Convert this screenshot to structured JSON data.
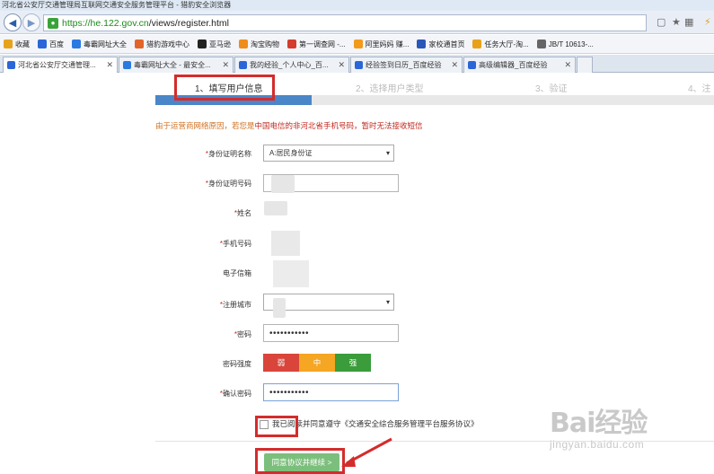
{
  "window": {
    "title": "河北省公安厅交通管理局互联网交通安全服务管理平台 - 猎豹安全浏览器"
  },
  "address": {
    "scheme": "https://",
    "host": "he.122.gov.cn",
    "path": "/views/register.html"
  },
  "favorites": [
    {
      "label": "收藏",
      "color": "#e8a21a"
    },
    {
      "label": "百度",
      "color": "#2b66d9"
    },
    {
      "label": "毒霸网址大全",
      "color": "#2a7ae2"
    },
    {
      "label": "猎豹游戏中心",
      "color": "#e2652a"
    },
    {
      "label": "亚马逊",
      "color": "#222222"
    },
    {
      "label": "淘宝购物",
      "color": "#f08c1a"
    },
    {
      "label": "第一调查网 -...",
      "color": "#d43c2c"
    },
    {
      "label": "阿里妈妈 赚...",
      "color": "#f39a1a"
    },
    {
      "label": "家校通首页",
      "color": "#2a58b8"
    },
    {
      "label": "任务大厅-淘...",
      "color": "#e8a21a"
    },
    {
      "label": "JB/T 10613-...",
      "color": "#666666"
    }
  ],
  "tabs": [
    {
      "label": "河北省公安厅交通管理...",
      "color": "#2b66d9",
      "active": true
    },
    {
      "label": "毒霸网址大全 - 最安全...",
      "color": "#2a7ae2",
      "active": false
    },
    {
      "label": "我的经验_个人中心_百...",
      "color": "#2b66d9",
      "active": false
    },
    {
      "label": "经验签到日历_百度经验",
      "color": "#2b66d9",
      "active": false
    },
    {
      "label": "高级编辑器_百度经验",
      "color": "#2b66d9",
      "active": false
    }
  ],
  "steps": [
    "1、填写用户信息",
    "2、选择用户类型",
    "3、验证",
    "4、注"
  ],
  "progress": {
    "completed_fraction": 0.28
  },
  "notice": {
    "part1": "由于运营商网络原因，若您是",
    "part2": "中国电信的非河北省手机号码，暂时无法接收短信"
  },
  "form": {
    "id_type_label": "身份证明名称",
    "id_type_value": "A:居民身份证",
    "id_number_label": "身份证明号码",
    "name_label": "姓名",
    "phone_label": "手机号码",
    "email_label": "电子信箱",
    "city_label": "注册城市",
    "password_label": "密码",
    "password_value": "•••••••••••",
    "strength_label": "密码强度",
    "strength": [
      {
        "label": "弱",
        "color": "#d9453a"
      },
      {
        "label": "中",
        "color": "#f5a623"
      },
      {
        "label": "强",
        "color": "#3a9c3a"
      }
    ],
    "confirm_label": "确认密码",
    "confirm_value": "•••••••••••"
  },
  "agree": {
    "text": "我已阅读并同意遵守《交通安全综合服务管理平台服务协议》"
  },
  "submit": {
    "label": "同意协议并继续 >"
  },
  "watermark": {
    "main": "Bai经验",
    "sub": "jingyan.baidu.com"
  }
}
